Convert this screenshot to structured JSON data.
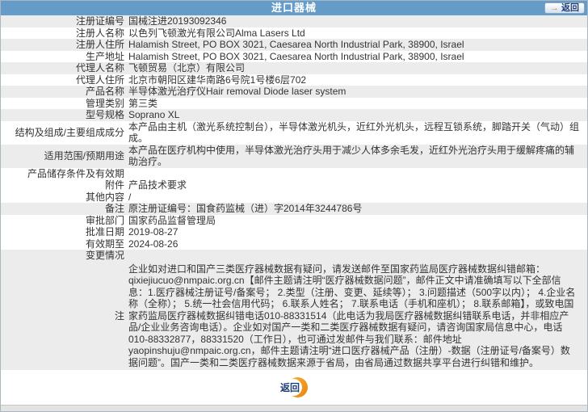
{
  "header": {
    "title": "进口器械",
    "back_label": "返回"
  },
  "colors": {
    "header_bg": "#649bc8",
    "row_shade": "#ececec",
    "accent_orange": "#f0941e",
    "button_navy": "#1f3f77"
  },
  "table": {
    "rows": [
      {
        "label": "注册证编号",
        "value": "国械注进20193092346"
      },
      {
        "label": "注册人名称",
        "value": "以色列飞顿激光有限公司Alma Lasers Ltd"
      },
      {
        "label": "注册人住所",
        "value": "Halamish Street, PO BOX 3021, Caesarea North Industrial Park, 38900, Israel"
      },
      {
        "label": "生产地址",
        "value": "Halamish Street, PO BOX 3021, Caesarea North Industrial Park, 38900, Israel"
      },
      {
        "label": "代理人名称",
        "value": "飞顿贸易（北京）有限公司"
      },
      {
        "label": "代理人住所",
        "value": "北京市朝阳区建华南路6号院1号楼6层702"
      },
      {
        "label": "产品名称",
        "value": "半导体激光治疗仪Hair removal Diode laser system"
      },
      {
        "label": "管理类别",
        "value": "第三类"
      },
      {
        "label": "型号规格",
        "value": "Soprano XL"
      },
      {
        "label": "结构及组成/主要组成成分",
        "value": "本产品由主机（激光系统控制台），半导体激光机头，近红外光机头，远程互锁系统，脚踏开关（气动）组成。"
      },
      {
        "label": "适用范围/预期用途",
        "value": "本产品在医疗机构中使用，半导体激光治疗头用于减少人体多余毛发，近红外光治疗头用于缓解疼痛的辅助治疗。"
      },
      {
        "label": "产品储存条件及有效期",
        "value": ""
      },
      {
        "label": "附件",
        "value": "产品技术要求"
      },
      {
        "label": "其他内容",
        "value": "/"
      },
      {
        "label": "备注",
        "value": "原注册证编号：国食药监械（进）字2014年3244786号"
      },
      {
        "label": "审批部门",
        "value": "国家药品监督管理局"
      },
      {
        "label": "批准日期",
        "value": "2019-08-27"
      },
      {
        "label": "有效期至",
        "value": "2024-08-26"
      },
      {
        "label": "变更情况",
        "value": ""
      },
      {
        "label": "注",
        "value": "企业如对进口和国产三类医疗器械数据有疑问，请发送邮件至国家药监局医疗器械数据纠错邮箱：qixiejiucuo@nmpaic.org.cn【邮件主题请注明“医疗器械数据问题”，邮件正文中请准确填写以下全部信息：1.医疗器械注册证号/备案号； 2.类型（注册、变更、延续等）； 3.问题描述（500字以内）； 4.企业名称（全称）； 5.统一社会信用代码； 6.联系人姓名； 7.联系电话（手机和座机）； 8.联系邮箱】，或致电国家药监局医疗器械数据纠错电话010-88331514（此电话为我局医疗器械数据纠错联系电话，并非相应产品/企业业务咨询电话）。企业如对国产一类和二类医疗器械数据有疑问，请咨询国家局信息中心，电话010-88332877，88331520（工作日），也可通过发邮件与我们联系：邮件地址yaopinshuju@nmpaic.org.cn，邮件主题请注明“进口医疗器械产品（注册）-数据（注册证号/备案号）数据问题”。国产一类和二类医疗器械数据来源于省局，由省局通过数据共享平台进行纠错和维护。"
      }
    ]
  },
  "footer": {
    "return_label": "返回"
  }
}
